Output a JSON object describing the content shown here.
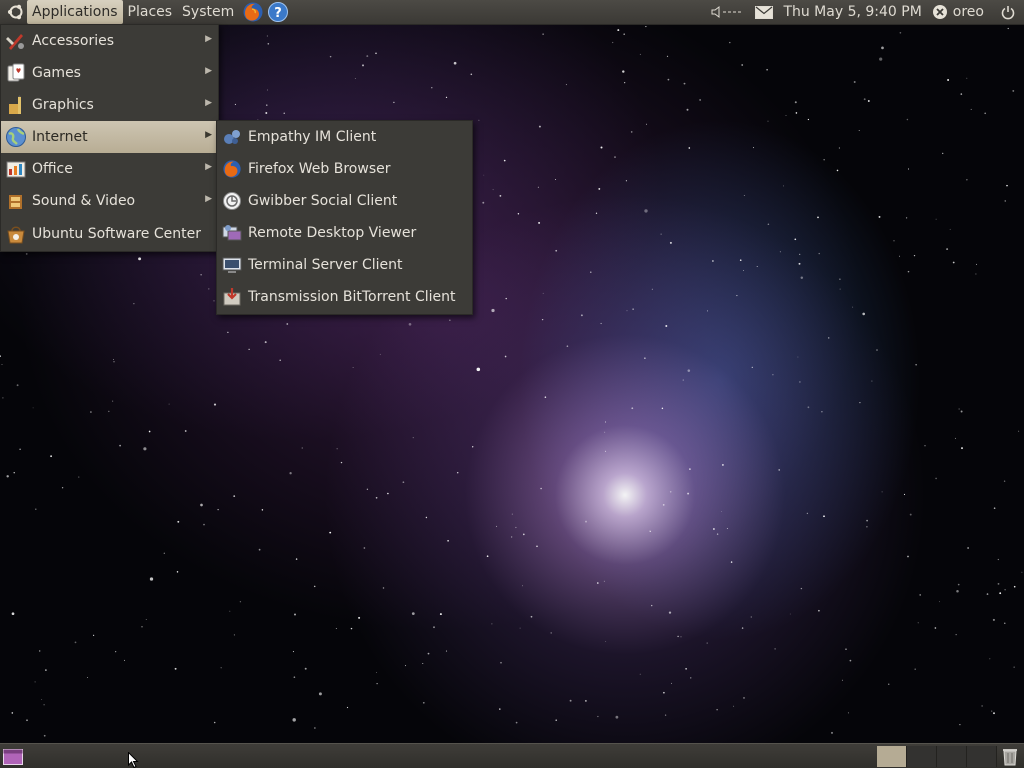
{
  "top_panel": {
    "menus": {
      "applications": "Applications",
      "places": "Places",
      "system": "System"
    },
    "launchers": [
      {
        "name": "firefox-icon"
      },
      {
        "name": "help-icon",
        "glyph": "?"
      }
    ],
    "tray": {
      "volume_label": "◁---",
      "clock": "Thu May  5,  9:40 PM",
      "user": "oreo"
    }
  },
  "applications_menu": {
    "items": [
      {
        "label": "Accessories",
        "icon": "accessories-icon",
        "has_submenu": true
      },
      {
        "label": "Games",
        "icon": "games-icon",
        "has_submenu": true
      },
      {
        "label": "Graphics",
        "icon": "graphics-icon",
        "has_submenu": true
      },
      {
        "label": "Internet",
        "icon": "internet-icon",
        "has_submenu": true,
        "highlighted": true
      },
      {
        "label": "Office",
        "icon": "office-icon",
        "has_submenu": true
      },
      {
        "label": "Sound & Video",
        "icon": "sound-video-icon",
        "has_submenu": true
      },
      {
        "label": "Ubuntu Software Center",
        "icon": "software-center-icon",
        "has_submenu": false
      }
    ]
  },
  "internet_submenu": {
    "items": [
      {
        "label": "Empathy IM Client",
        "icon": "empathy-icon"
      },
      {
        "label": "Firefox Web Browser",
        "icon": "firefox-icon"
      },
      {
        "label": "Gwibber Social Client",
        "icon": "gwibber-icon"
      },
      {
        "label": "Remote Desktop Viewer",
        "icon": "remote-desktop-icon"
      },
      {
        "label": "Terminal Server Client",
        "icon": "terminal-server-icon"
      },
      {
        "label": "Transmission BitTorrent Client",
        "icon": "transmission-icon"
      }
    ]
  },
  "bottom_panel": {
    "workspaces": [
      {
        "active": true
      },
      {
        "active": false
      },
      {
        "active": false
      },
      {
        "active": false
      }
    ]
  },
  "colors": {
    "panel": "#3c3b37",
    "menu_highlight": "#c4bba5",
    "text": "#dfdbd2",
    "wallpaper_glow": "#d9b8ff"
  }
}
